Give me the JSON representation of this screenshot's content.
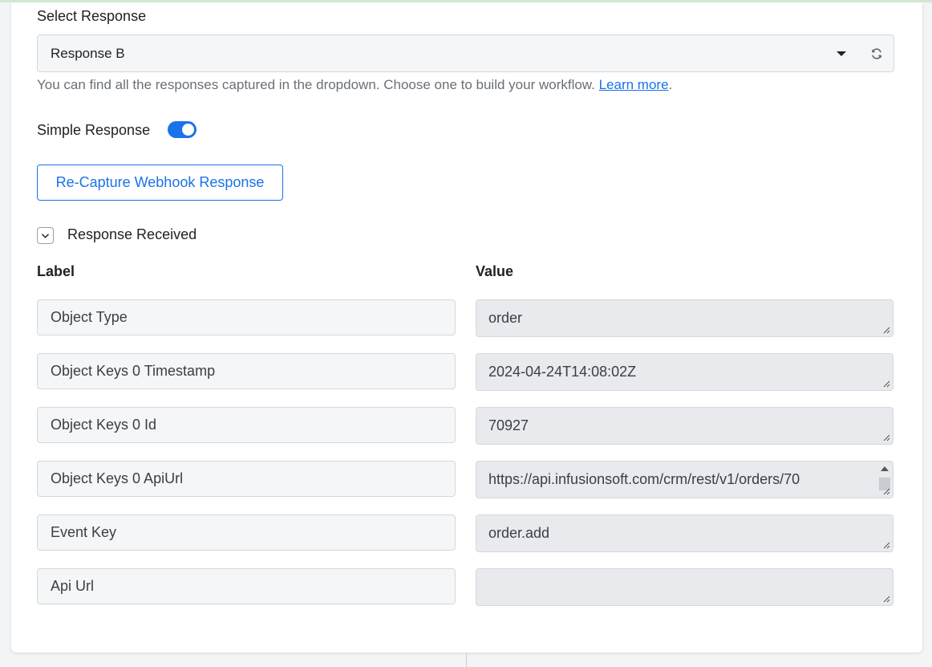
{
  "select_response": {
    "label": "Select Response",
    "selected_value": "Response B",
    "help_text": "You can find all the responses captured in the dropdown. Choose one to build your workflow.",
    "help_link": "Learn more",
    "help_suffix": "."
  },
  "simple_response": {
    "label": "Simple Response",
    "enabled": true
  },
  "recapture_button": "Re-Capture Webhook Response",
  "response_received": {
    "title": "Response Received",
    "label_header": "Label",
    "value_header": "Value",
    "rows": [
      {
        "label": "Object Type",
        "value": "order"
      },
      {
        "label": "Object Keys 0 Timestamp",
        "value": "2024-04-24T14:08:02Z"
      },
      {
        "label": "Object Keys 0 Id",
        "value": "70927"
      },
      {
        "label": "Object Keys 0 ApiUrl",
        "value": "https://api.infusionsoft.com/crm/rest/v1/orders/70"
      },
      {
        "label": "Event Key",
        "value": "order.add"
      },
      {
        "label": "Api Url",
        "value": ""
      }
    ]
  },
  "colors": {
    "accent": "#1a73e8",
    "field_bg": "#f4f6f8",
    "value_bg": "#e8eaed"
  }
}
